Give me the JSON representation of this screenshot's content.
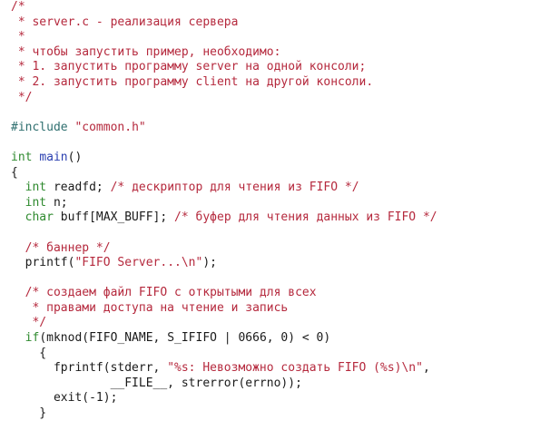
{
  "colors": {
    "comment": "#b5293d",
    "type": "#2f8a2f",
    "keyword": "#2f8a2f",
    "function": "#2a3fb0",
    "string": "#b5293d",
    "preprocessor": "#2f6f6f",
    "plain": "#1a1a1a",
    "background": "#ffffff"
  },
  "lines": [
    [
      {
        "t": "comment",
        "v": "/*"
      }
    ],
    [
      {
        "t": "comment",
        "v": " * server.c - реализация сервера"
      }
    ],
    [
      {
        "t": "comment",
        "v": " *"
      }
    ],
    [
      {
        "t": "comment",
        "v": " * чтобы запустить пример, необходимо:"
      }
    ],
    [
      {
        "t": "comment",
        "v": " * 1. запустить программу server на одной консоли;"
      }
    ],
    [
      {
        "t": "comment",
        "v": " * 2. запустить программу client на другой консоли."
      }
    ],
    [
      {
        "t": "comment",
        "v": " */"
      }
    ],
    [],
    [
      {
        "t": "preproc",
        "v": "#include "
      },
      {
        "t": "string",
        "v": "\"common.h\""
      }
    ],
    [],
    [
      {
        "t": "type",
        "v": "int"
      },
      {
        "t": "plain",
        "v": " "
      },
      {
        "t": "func",
        "v": "main"
      },
      {
        "t": "plain",
        "v": "()"
      }
    ],
    [
      {
        "t": "plain",
        "v": "{"
      }
    ],
    [
      {
        "t": "plain",
        "v": "  "
      },
      {
        "t": "type",
        "v": "int"
      },
      {
        "t": "plain",
        "v": " readfd; "
      },
      {
        "t": "comment",
        "v": "/* дескриптор для чтения из FIFO */"
      }
    ],
    [
      {
        "t": "plain",
        "v": "  "
      },
      {
        "t": "type",
        "v": "int"
      },
      {
        "t": "plain",
        "v": " n;"
      }
    ],
    [
      {
        "t": "plain",
        "v": "  "
      },
      {
        "t": "type",
        "v": "char"
      },
      {
        "t": "plain",
        "v": " buff[MAX_BUFF]; "
      },
      {
        "t": "comment",
        "v": "/* буфер для чтения данных из FIFO */"
      }
    ],
    [],
    [
      {
        "t": "plain",
        "v": "  "
      },
      {
        "t": "comment",
        "v": "/* баннер */"
      }
    ],
    [
      {
        "t": "plain",
        "v": "  printf("
      },
      {
        "t": "string",
        "v": "\"FIFO Server...\\n\""
      },
      {
        "t": "plain",
        "v": ");"
      }
    ],
    [],
    [
      {
        "t": "plain",
        "v": "  "
      },
      {
        "t": "comment",
        "v": "/* создаем файл FIFO с открытыми для всех"
      }
    ],
    [
      {
        "t": "comment",
        "v": "   * правами доступа на чтение и запись"
      }
    ],
    [
      {
        "t": "comment",
        "v": "   */"
      }
    ],
    [
      {
        "t": "plain",
        "v": "  "
      },
      {
        "t": "keyword",
        "v": "if"
      },
      {
        "t": "plain",
        "v": "(mknod(FIFO_NAME, S_IFIFO | 0666, 0) < 0)"
      }
    ],
    [
      {
        "t": "plain",
        "v": "    {"
      }
    ],
    [
      {
        "t": "plain",
        "v": "      fprintf(stderr, "
      },
      {
        "t": "string",
        "v": "\"%s: Невозможно создать FIFO (%s)\\n\""
      },
      {
        "t": "plain",
        "v": ","
      }
    ],
    [
      {
        "t": "plain",
        "v": "              __FILE__, strerror(errno));"
      }
    ],
    [
      {
        "t": "plain",
        "v": "      exit(-1);"
      }
    ],
    [
      {
        "t": "plain",
        "v": "    }"
      }
    ]
  ]
}
